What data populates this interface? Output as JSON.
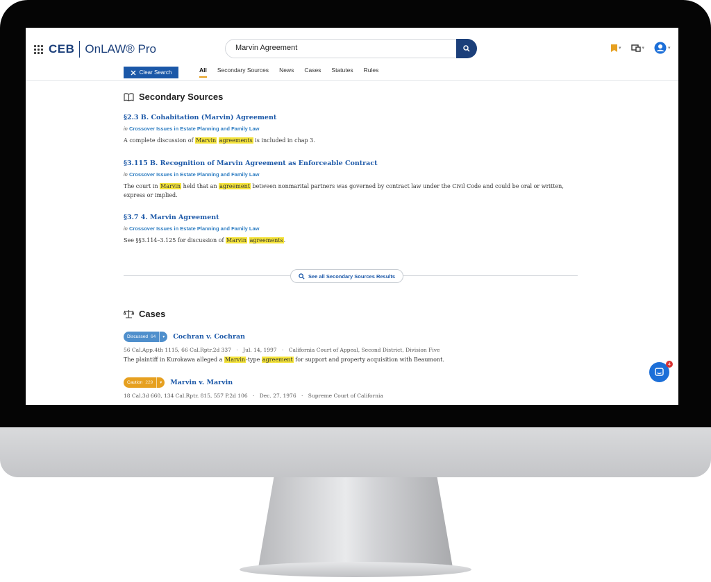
{
  "app": {
    "brand": "CEB",
    "product": "OnLAW® Pro"
  },
  "search": {
    "value": "Marvin Agreement"
  },
  "toolbar": {
    "clear_label": "Clear Search"
  },
  "tabs": [
    {
      "label": "All"
    },
    {
      "label": "Secondary Sources"
    },
    {
      "label": "News"
    },
    {
      "label": "Cases"
    },
    {
      "label": "Statutes"
    },
    {
      "label": "Rules"
    }
  ],
  "secondary": {
    "title": "Secondary Sources",
    "results": [
      {
        "title": "§2.3 B. Cohabitation (Marvin) Agreement",
        "in": "in",
        "source": "Crossover Issues in Estate Planning and Family Law",
        "snippet": [
          "A complete discussion of ",
          "Marvin",
          " ",
          "agreements",
          " is included in chap 3."
        ]
      },
      {
        "title": "§3.115 B. Recognition of Marvin Agreement as Enforceable Contract",
        "in": "in",
        "source": "Crossover Issues in Estate Planning and Family Law",
        "snippet": [
          "The court in ",
          "Marvin",
          " held that an ",
          "agreement",
          " between nonmarital partners was governed by contract law under the Civil Code and could be oral or written, express or implied."
        ]
      },
      {
        "title": "§3.7 4. Marvin Agreement",
        "in": "in",
        "source": "Crossover Issues in Estate Planning and Family Law",
        "snippet": [
          "See §§3.114–3.125 for discussion of ",
          "Marvin",
          " ",
          "agreements",
          "."
        ]
      }
    ],
    "see_all": "See all Secondary Sources Results"
  },
  "cases": {
    "title": "Cases",
    "items": [
      {
        "badge": "Discussed",
        "count": "64",
        "badge_color": "#4f8fcc",
        "name": "Cochran v. Cochran",
        "citation": "56 Cal.App.4th 1115, 66 Cal.Rptr.2d 337",
        "date": "Jul. 14, 1997",
        "court": "California Court of Appeal, Second District, Division Five",
        "snippet": [
          "The plaintiff in Kurokawa alleged a ",
          "Marvin",
          "-type ",
          "agreement",
          " for support and property acquisition with Beaumont."
        ]
      },
      {
        "badge": "Caution",
        "count": "229",
        "badge_color": "#e6a020",
        "name": "Marvin v. Marvin",
        "citation": "18 Cal.3d 660, 134 Cal.Rptr. 815, 557 P.2d 106",
        "date": "Dec. 27, 1976",
        "court": "Supreme Court of California"
      }
    ],
    "dot": "·"
  },
  "chat": {
    "unread": "4"
  },
  "colors": {
    "brand": "#1b3f7a",
    "link": "#1d59a8",
    "highlight": "#f5e43a",
    "tab_active": "#e6a020"
  }
}
